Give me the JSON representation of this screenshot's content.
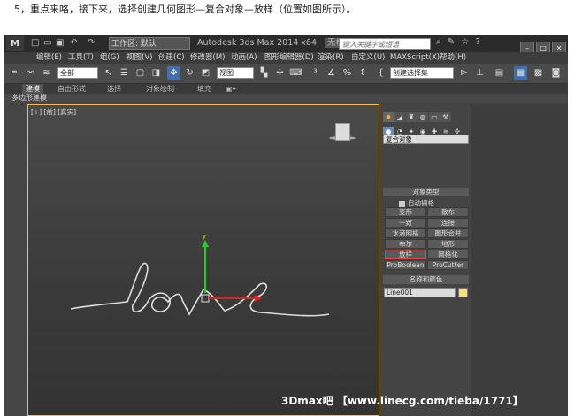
{
  "intro": "5，重点来咯，接下来，选择创建几何图形—复合对象—放样（位置如图所示）。",
  "titlebar": {
    "workspace": "工作区: 默认",
    "app_title": "Autodesk 3ds Max  2014 x64",
    "file_name": "无标题",
    "search_placeholder": "键入关键字或短语"
  },
  "menu": [
    "编辑(E)",
    "工具(T)",
    "组(G)",
    "视图(V)",
    "创建(C)",
    "修改器(M)",
    "动画(A)",
    "图形编辑器(D)",
    "渲染(R)",
    "自定义(U)",
    "MAXScript(X)",
    "帮助(H)"
  ],
  "toolbar": {
    "filter": "全部",
    "ref_coord": "视图",
    "selection_set": "创建选择集"
  },
  "ribbon": {
    "tabs": [
      "建模",
      "自由形式",
      "选择",
      "对象绘制",
      "填充"
    ],
    "sub_label": "多边形建模"
  },
  "viewport": {
    "label": "[+] [前] [真实]",
    "watermark": "3Dmax吧 【www.linecg.com/tieba/1771】"
  },
  "command_panel": {
    "category": "复合对象",
    "object_type_title": "对象类型",
    "auto_grid": "自动栅格",
    "buttons": [
      "变形",
      "散布",
      "一致",
      "连接",
      "水滴网格",
      "图形合并",
      "布尔",
      "地形",
      "放样",
      "网格化",
      "ProBoolean",
      "ProCutter"
    ],
    "selected_button": "放样",
    "name_color_title": "名称和颜色",
    "object_name": "Line001",
    "object_color": "#f5e078"
  },
  "colors": {
    "gizmo_y": "#22cc22",
    "gizmo_x": "#e02020",
    "viewport_border": "#f0c040"
  }
}
